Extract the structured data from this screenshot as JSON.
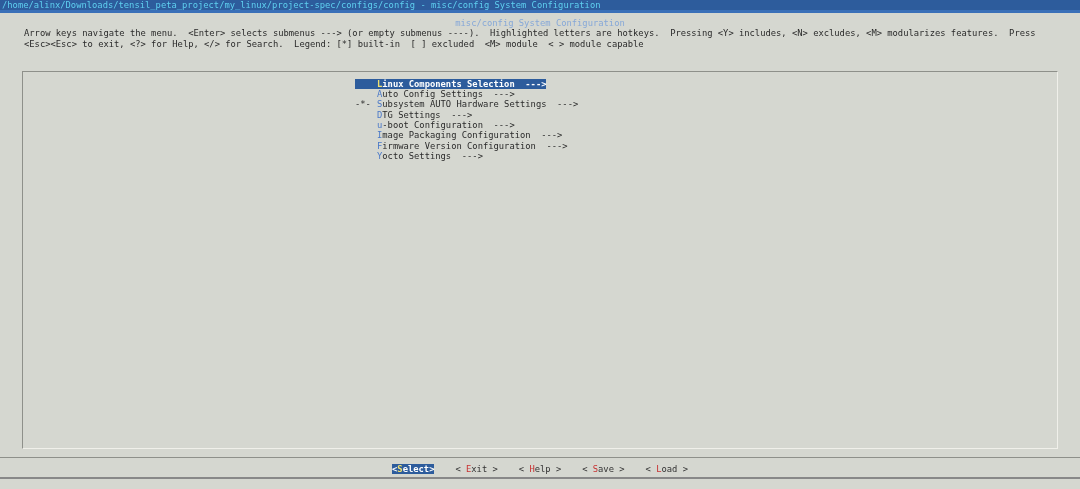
{
  "window": {
    "title": "/home/alinx/Downloads/tensil_peta_project/my_linux/project-spec/configs/config - misc/config System Configuration"
  },
  "dialog": {
    "title": "misc/config System Configuration",
    "help": [
      "Arrow keys navigate the menu.  <Enter> selects submenus ---> (or empty submenus ----).  Highlighted letters are hotkeys.  Pressing <Y> includes, <N> excludes, <M> modularizes features.  Press",
      "<Esc><Esc> to exit, <?> for Help, </> for Search.  Legend: [*] built-in  [ ] excluded  <M> module  < > module capable"
    ]
  },
  "menu": [
    {
      "label": "Linux Components Selection  --->",
      "selected": true
    },
    {
      "label": "Auto Config Settings  --->",
      "selected": false
    },
    {
      "prefix": "-*-",
      "label": "Subsystem AUTO Hardware Settings  --->",
      "selected": false
    },
    {
      "label": "DTG Settings  --->",
      "selected": false
    },
    {
      "label": "u-boot Configuration  --->",
      "selected": false
    },
    {
      "label": "Image Packaging Configuration  --->",
      "selected": false
    },
    {
      "label": "Firmware Version Configuration  --->",
      "selected": false
    },
    {
      "label": "Yocto Settings  --->",
      "selected": false
    }
  ],
  "buttons": [
    {
      "label": "<Select>",
      "selected": true
    },
    {
      "label": "< Exit >",
      "selected": false
    },
    {
      "label": "< Help >",
      "selected": false
    },
    {
      "label": "< Save >",
      "selected": false
    },
    {
      "label": "< Load >",
      "selected": false
    }
  ]
}
